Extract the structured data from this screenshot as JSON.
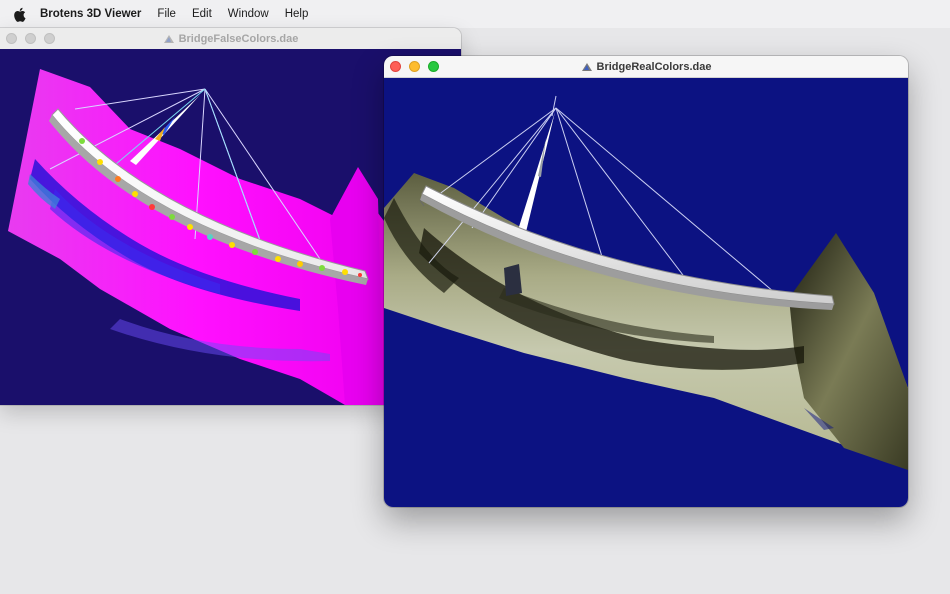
{
  "menubar": {
    "apple_icon": "apple-logo-icon",
    "app_name": "Brotens 3D Viewer",
    "items": [
      "File",
      "Edit",
      "Window",
      "Help"
    ]
  },
  "windows": [
    {
      "title": "BridgeFalseColors.dae",
      "active": false,
      "icon": "3d-document-icon",
      "viewport_background": "#1a0f6b",
      "terrain_color": "#ff00ff"
    },
    {
      "title": "BridgeRealColors.dae",
      "active": true,
      "icon": "3d-document-icon",
      "viewport_background": "#0c1282",
      "terrain_color": "#9a9c72"
    }
  ],
  "colors": {
    "menubar_bg": "#f0f0f2",
    "desktop_bg": "#e7e7e9",
    "close": "#fe5f57",
    "minimize": "#febc2e",
    "zoom": "#28c840"
  }
}
